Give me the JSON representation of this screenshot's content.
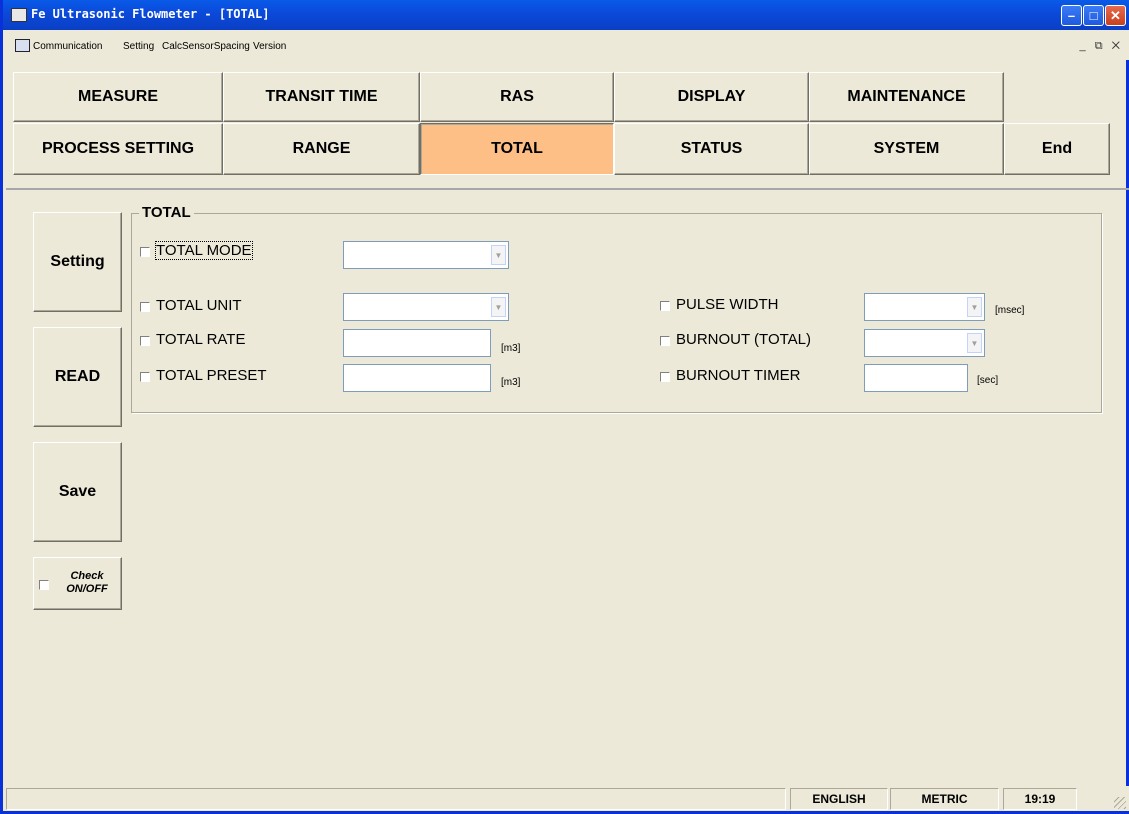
{
  "window": {
    "title": "Fe Ultrasonic Flowmeter - [TOTAL]"
  },
  "menu": {
    "communication": "Communication",
    "setting": "Setting",
    "calc": "CalcSensorSpacing",
    "version": "Version"
  },
  "tabs": {
    "measure": "MEASURE",
    "transit_time": "TRANSIT TIME",
    "ras": "RAS",
    "display": "DISPLAY",
    "maintenance": "MAINTENANCE",
    "process_setting": "PROCESS SETTING",
    "range": "RANGE",
    "total": "TOTAL",
    "status": "STATUS",
    "system": "SYSTEM",
    "end": "End",
    "active": "TOTAL",
    "active_color": "#fdbf86"
  },
  "side": {
    "setting": "Setting",
    "read": "READ",
    "save": "Save",
    "check_line1": "Check",
    "check_line2": "ON/OFF"
  },
  "group": {
    "title": "TOTAL",
    "total_mode": {
      "label": "TOTAL MODE",
      "value": ""
    },
    "total_unit": {
      "label": "TOTAL UNIT",
      "value": ""
    },
    "total_rate": {
      "label": "TOTAL RATE",
      "value": "",
      "unit": "[m3]"
    },
    "total_preset": {
      "label": "TOTAL PRESET",
      "value": "",
      "unit": "[m3]"
    },
    "pulse_width": {
      "label": "PULSE WIDTH",
      "value": "",
      "unit": "[msec]"
    },
    "burnout_total": {
      "label": "BURNOUT (TOTAL)",
      "value": ""
    },
    "burnout_timer": {
      "label": "BURNOUT TIMER",
      "value": "",
      "unit": "[sec]"
    }
  },
  "status": {
    "language": "ENGLISH",
    "units": "METRIC",
    "time": "19:19"
  }
}
